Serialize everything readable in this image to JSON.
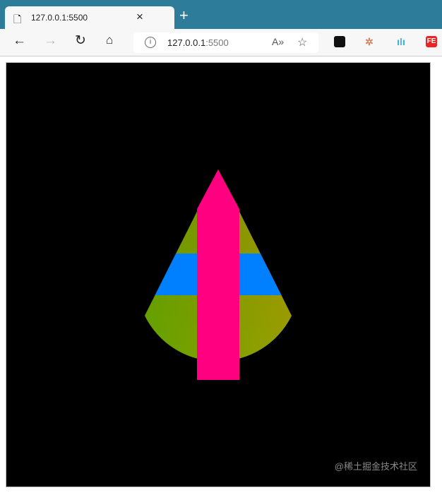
{
  "tab": {
    "title": "127.0.0.1:5500",
    "icon": "page-icon"
  },
  "address": {
    "host": "127.0.0.1",
    "port": ":5500"
  },
  "extensions": [
    "ext-dark-icon",
    "ext-tree-icon",
    "ext-audio-icon",
    "ext-fe-icon"
  ],
  "ext_fe_label": "FE",
  "colors": {
    "pink": "#ff0080",
    "blue": "#0080ff",
    "olive": "#7a6a00",
    "green": "#5ea800",
    "yellow": "#a8a400"
  },
  "watermark": "@稀土掘金技术社区"
}
